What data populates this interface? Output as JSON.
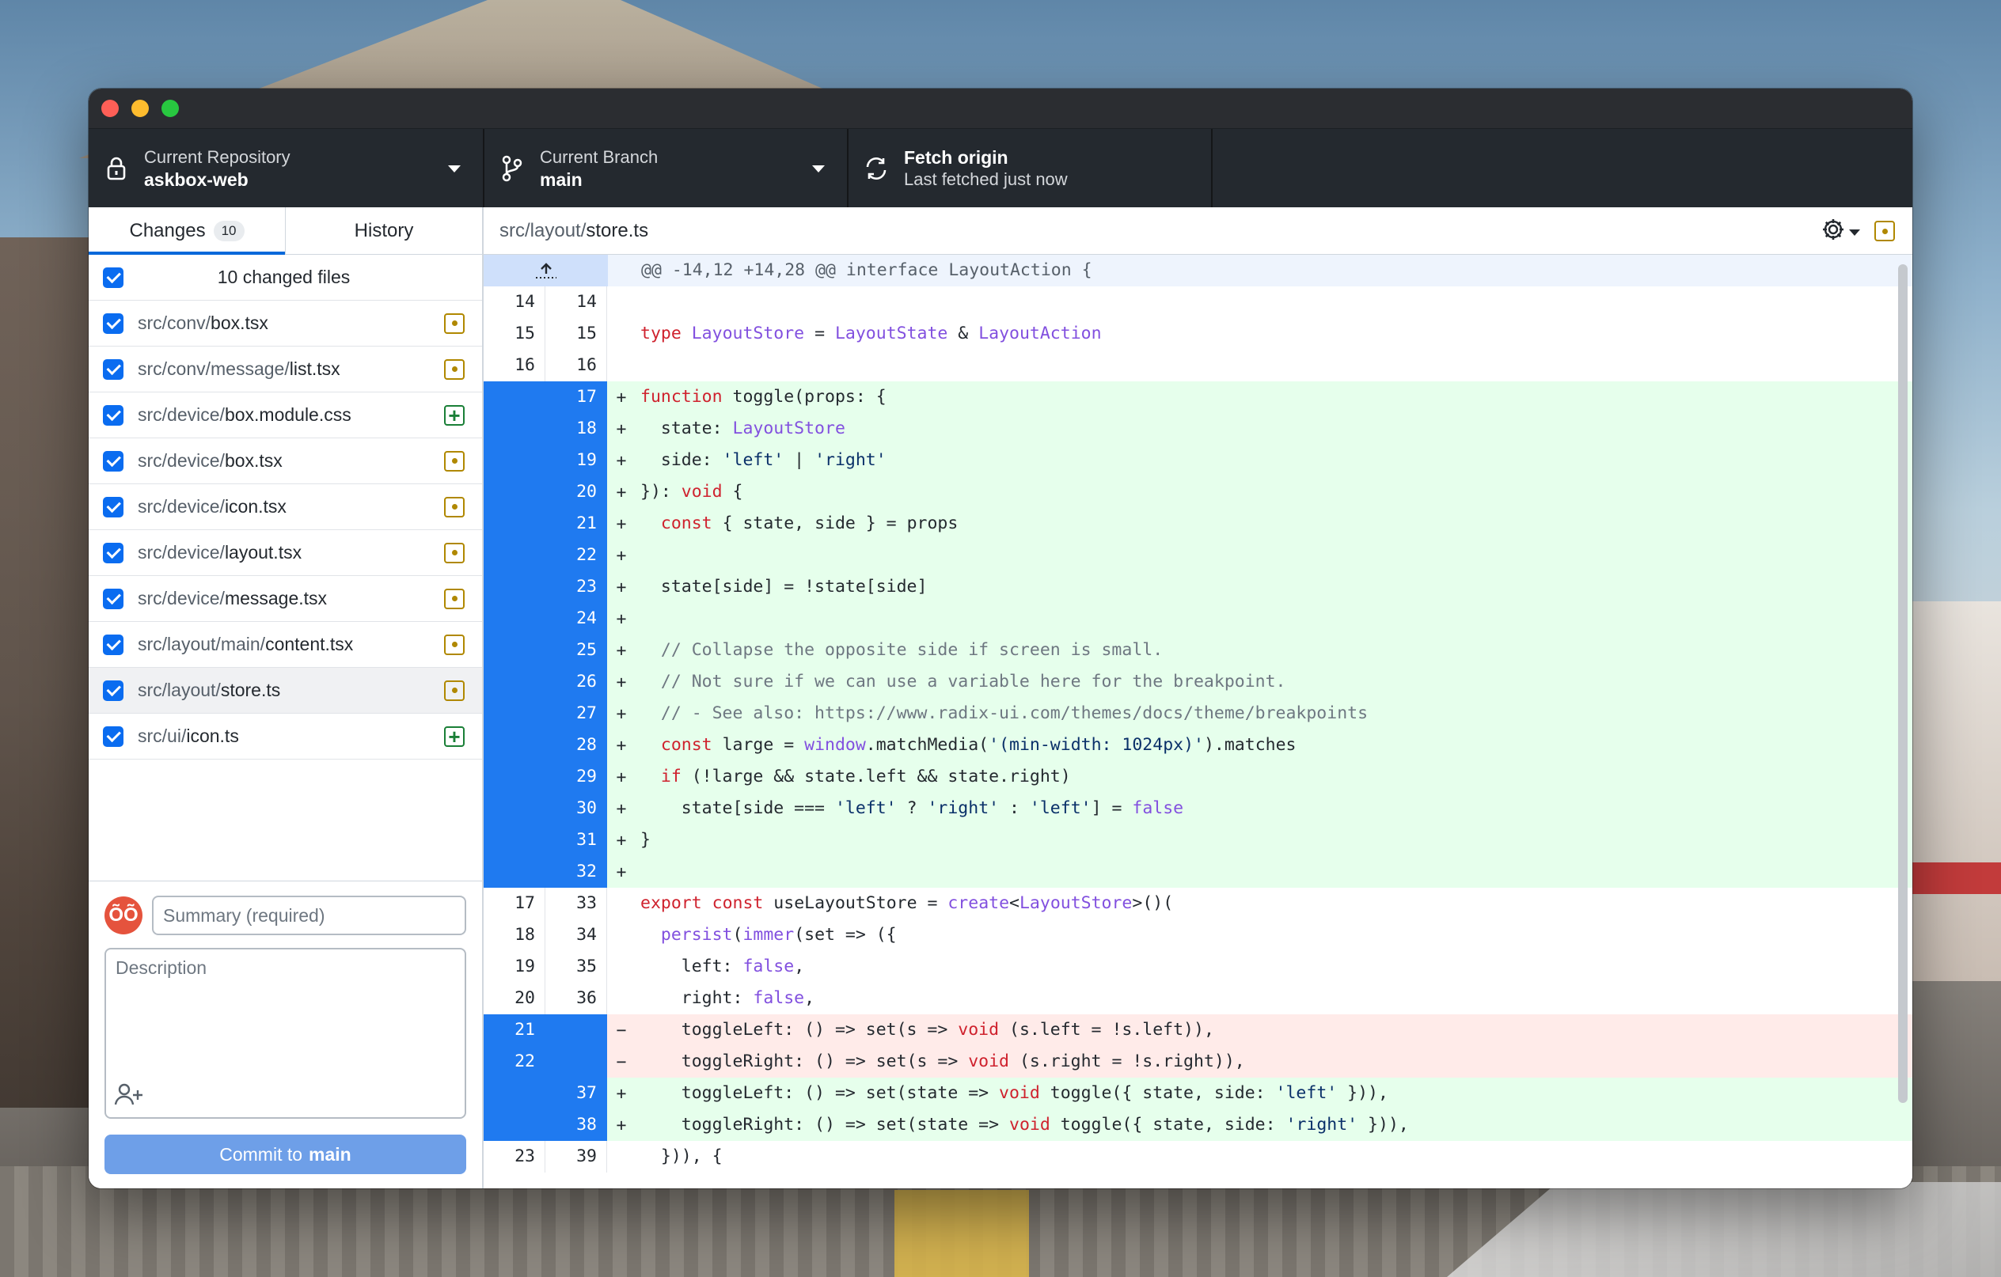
{
  "toolbar": {
    "repo_label": "Current Repository",
    "repo_name": "askbox-web",
    "branch_label": "Current Branch",
    "branch_name": "main",
    "fetch_title": "Fetch origin",
    "fetch_sub": "Last fetched just now"
  },
  "tabs": {
    "changes": "Changes",
    "changes_count": "10",
    "history": "History"
  },
  "files_header": "10 changed files",
  "files": [
    {
      "dir": "src/conv/",
      "name": "box.tsx",
      "status": "modified"
    },
    {
      "dir": "src/conv/message/",
      "name": "list.tsx",
      "status": "modified"
    },
    {
      "dir": "src/device/",
      "name": "box.module.css",
      "status": "added"
    },
    {
      "dir": "src/device/",
      "name": "box.tsx",
      "status": "modified"
    },
    {
      "dir": "src/device/",
      "name": "icon.tsx",
      "status": "modified"
    },
    {
      "dir": "src/device/",
      "name": "layout.tsx",
      "status": "modified"
    },
    {
      "dir": "src/device/",
      "name": "message.tsx",
      "status": "modified"
    },
    {
      "dir": "src/layout/main/",
      "name": "content.tsx",
      "status": "modified"
    },
    {
      "dir": "src/layout/",
      "name": "store.ts",
      "status": "modified"
    },
    {
      "dir": "src/ui/",
      "name": "icon.ts",
      "status": "added"
    }
  ],
  "commit": {
    "avatar_text": "ÕÕ",
    "summary_placeholder": "Summary (required)",
    "description_placeholder": "Description",
    "button_prefix": "Commit to",
    "button_branch": "main"
  },
  "diff": {
    "path_dir": "src/layout/",
    "path_file": "store.ts",
    "hunk_header": "@@ -14,12 +14,28 @@ interface LayoutAction {",
    "lines": [
      {
        "old": "14",
        "new": "14",
        "sign": "",
        "type": "ctx",
        "code": ""
      },
      {
        "old": "15",
        "new": "15",
        "sign": "",
        "type": "ctx",
        "code": "type LayoutStore = LayoutState & LayoutAction"
      },
      {
        "old": "16",
        "new": "16",
        "sign": "",
        "type": "ctx",
        "code": ""
      },
      {
        "old": "",
        "new": "17",
        "sign": "+",
        "type": "add",
        "code": "function toggle(props: {"
      },
      {
        "old": "",
        "new": "18",
        "sign": "+",
        "type": "add",
        "code": "  state: LayoutStore"
      },
      {
        "old": "",
        "new": "19",
        "sign": "+",
        "type": "add",
        "code": "  side: 'left' | 'right'"
      },
      {
        "old": "",
        "new": "20",
        "sign": "+",
        "type": "add",
        "code": "}): void {"
      },
      {
        "old": "",
        "new": "21",
        "sign": "+",
        "type": "add",
        "code": "  const { state, side } = props"
      },
      {
        "old": "",
        "new": "22",
        "sign": "+",
        "type": "add",
        "code": ""
      },
      {
        "old": "",
        "new": "23",
        "sign": "+",
        "type": "add",
        "code": "  state[side] = !state[side]"
      },
      {
        "old": "",
        "new": "24",
        "sign": "+",
        "type": "add",
        "code": ""
      },
      {
        "old": "",
        "new": "25",
        "sign": "+",
        "type": "add",
        "code": "  // Collapse the opposite side if screen is small."
      },
      {
        "old": "",
        "new": "26",
        "sign": "+",
        "type": "add",
        "code": "  // Not sure if we can use a variable here for the breakpoint."
      },
      {
        "old": "",
        "new": "27",
        "sign": "+",
        "type": "add",
        "code": "  // - See also: https://www.radix-ui.com/themes/docs/theme/breakpoints"
      },
      {
        "old": "",
        "new": "28",
        "sign": "+",
        "type": "add",
        "code": "  const large = window.matchMedia('(min-width: 1024px)').matches"
      },
      {
        "old": "",
        "new": "29",
        "sign": "+",
        "type": "add",
        "code": "  if (!large && state.left && state.right)"
      },
      {
        "old": "",
        "new": "30",
        "sign": "+",
        "type": "add",
        "code": "    state[side === 'left' ? 'right' : 'left'] = false"
      },
      {
        "old": "",
        "new": "31",
        "sign": "+",
        "type": "add",
        "code": "}"
      },
      {
        "old": "",
        "new": "32",
        "sign": "+",
        "type": "add",
        "code": ""
      },
      {
        "old": "17",
        "new": "33",
        "sign": "",
        "type": "ctx",
        "code": "export const useLayoutStore = create<LayoutStore>()("
      },
      {
        "old": "18",
        "new": "34",
        "sign": "",
        "type": "ctx",
        "code": "  persist(immer(set => ({"
      },
      {
        "old": "19",
        "new": "35",
        "sign": "",
        "type": "ctx",
        "code": "    left: false,"
      },
      {
        "old": "20",
        "new": "36",
        "sign": "",
        "type": "ctx",
        "code": "    right: false,"
      },
      {
        "old": "21",
        "new": "",
        "sign": "−",
        "type": "del",
        "code": "    toggleLeft: () => set(s => void (s.left = !s.left)),"
      },
      {
        "old": "22",
        "new": "",
        "sign": "−",
        "type": "del",
        "code": "    toggleRight: () => set(s => void (s.right = !s.right)),"
      },
      {
        "old": "",
        "new": "37",
        "sign": "+",
        "type": "add",
        "code": "    toggleLeft: () => set(state => void toggle({ state, side: 'left' })),"
      },
      {
        "old": "",
        "new": "38",
        "sign": "+",
        "type": "add",
        "code": "    toggleRight: () => set(state => void toggle({ state, side: 'right' })),"
      },
      {
        "old": "23",
        "new": "39",
        "sign": "",
        "type": "ctx",
        "code": "  })), {"
      }
    ]
  },
  "colors": {
    "accent": "#0969da",
    "selected_gutter": "#1f7af0",
    "added_bg": "#e6ffec",
    "deleted_bg": "#ffebe9",
    "toolbar_bg": "#24292f"
  },
  "icons": [
    "lock-icon",
    "branch-icon",
    "sync-icon",
    "gear-icon",
    "expand-up-icon",
    "add-coauthor-icon"
  ]
}
